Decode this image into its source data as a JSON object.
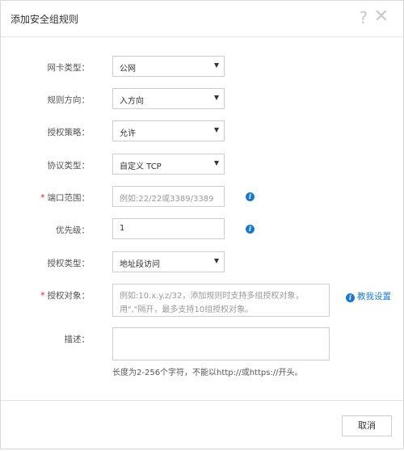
{
  "dialog": {
    "title": "添加安全组规则",
    "help_icon": "question-icon",
    "close_icon": "close-icon"
  },
  "form": {
    "nic_type": {
      "label": "网卡类型：",
      "value": "公网"
    },
    "direction": {
      "label": "规则方向：",
      "value": "入方向"
    },
    "policy": {
      "label": "授权策略：",
      "value": "允许"
    },
    "protocol": {
      "label": "协议类型：",
      "value": "自定义 TCP"
    },
    "port_range": {
      "required": "*",
      "label": "端口范围：",
      "placeholder": "例如:22/22或3389/3389"
    },
    "priority": {
      "label": "优先级：",
      "value": "1"
    },
    "auth_type": {
      "label": "授权类型：",
      "value": "地址段访问"
    },
    "auth_object": {
      "required": "*",
      "label": "授权对象：",
      "placeholder": "例如:10.x.y.z/32，添加规则时支持多组授权对象，用\",\"隔开，最多支持10组授权对象。",
      "help_link": "教我设置"
    },
    "description": {
      "label": "描述：",
      "hint": "长度为2-256个字符，不能以http://或https://开头。"
    }
  },
  "footer": {
    "cancel_label": "取消"
  }
}
